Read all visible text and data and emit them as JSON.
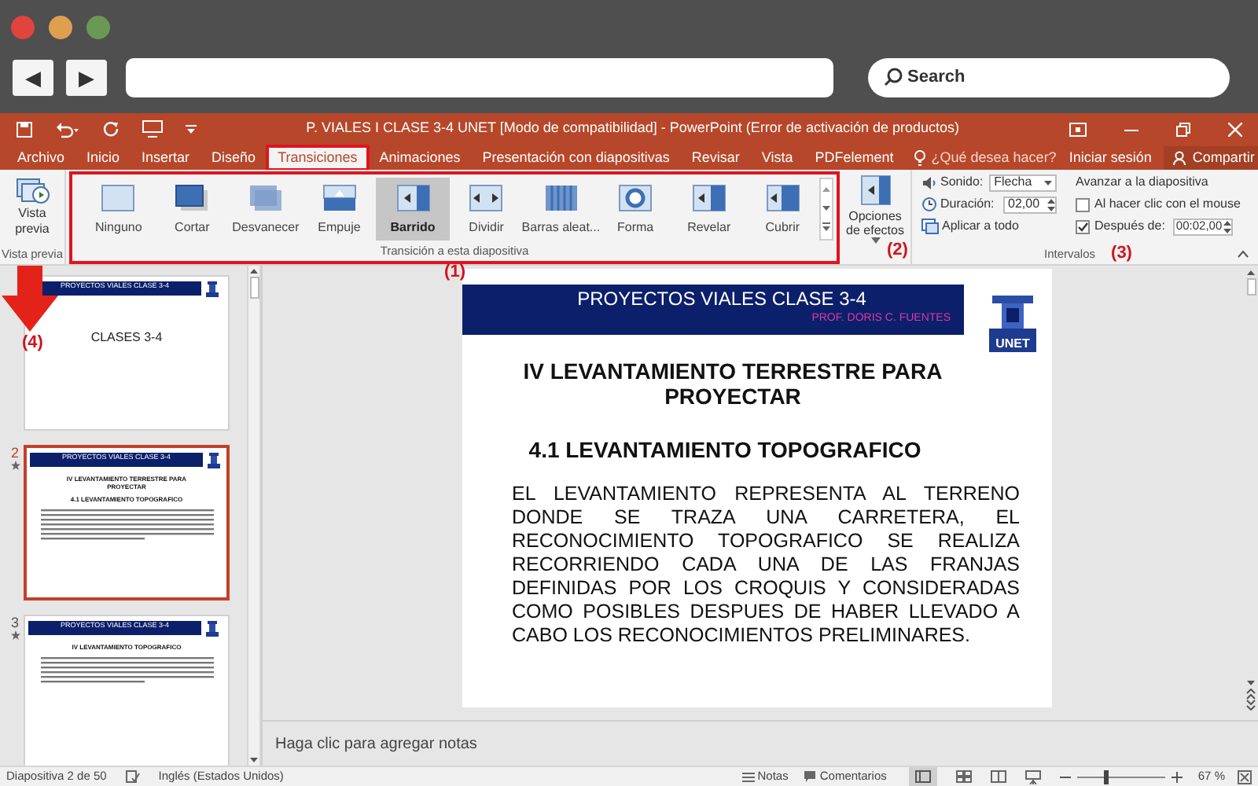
{
  "browser": {
    "back": "◀",
    "forward": "▶",
    "search_placeholder": "Search"
  },
  "app": {
    "title": "P. VIALES I  CLASE 3-4 UNET [Modo de compatibilidad] - PowerPoint (Error de activación de productos)",
    "tabs": [
      {
        "label": "Archivo",
        "selected": false
      },
      {
        "label": "Inicio",
        "selected": false
      },
      {
        "label": "Insertar",
        "selected": false
      },
      {
        "label": "Diseño",
        "selected": false
      },
      {
        "label": "Transiciones",
        "selected": true
      },
      {
        "label": "Animaciones",
        "selected": false
      },
      {
        "label": "Presentación con diapositivas",
        "selected": false
      },
      {
        "label": "Revisar",
        "selected": false
      },
      {
        "label": "Vista",
        "selected": false
      },
      {
        "label": "PDFelement",
        "selected": false
      }
    ],
    "tell_me": "¿Qué desea hacer?",
    "sign_in": "Iniciar sesión",
    "share": "Compartir"
  },
  "ribbon": {
    "preview": {
      "button": "Vista previa",
      "group_label": "Vista previa"
    },
    "gallery": {
      "group_label": "Transición a esta diapositiva",
      "annotation": "(1)",
      "items": [
        {
          "label": "Ninguno",
          "kind": "none",
          "selected": false
        },
        {
          "label": "Cortar",
          "kind": "cut",
          "selected": false
        },
        {
          "label": "Desvanecer",
          "kind": "fade",
          "selected": false
        },
        {
          "label": "Empuje",
          "kind": "push",
          "selected": false
        },
        {
          "label": "Barrido",
          "kind": "wipe",
          "selected": true
        },
        {
          "label": "Dividir",
          "kind": "split",
          "selected": false
        },
        {
          "label": "Barras aleat...",
          "kind": "bars",
          "selected": false
        },
        {
          "label": "Forma",
          "kind": "shape",
          "selected": false
        },
        {
          "label": "Revelar",
          "kind": "reveal",
          "selected": false
        },
        {
          "label": "Cubrir",
          "kind": "cover",
          "selected": false
        }
      ]
    },
    "effect_options": {
      "label": "Opciones de efectos",
      "annotation": "(2)"
    },
    "timing": {
      "group_label": "Intervalos",
      "annotation": "(3)",
      "sound": {
        "label": "Sonido:",
        "value": "Flecha"
      },
      "duration": {
        "label": "Duración:",
        "value": "02,00"
      },
      "apply_all": "Aplicar a todo",
      "advance_title": "Avanzar a la diapositiva",
      "on_click": {
        "label": "Al hacer clic con el mouse",
        "checked": false
      },
      "after": {
        "label": "Después de:",
        "checked": true,
        "value": "00:02,00"
      }
    }
  },
  "slides_pane": {
    "annotation": "(4)",
    "slides": [
      {
        "star": false,
        "selected": false,
        "header": "PROYECTOS VIALES  CLASE  3-4",
        "title": "CLASES 3-4",
        "kind": "cover"
      },
      {
        "number": "2",
        "star": true,
        "selected": true,
        "header": "PROYECTOS VIALES  CLASE  3-4",
        "title": "IV LEVANTAMIENTO TERRESTRE PARA PROYECTAR",
        "subtitle": "4.1  LEVANTAMIENTO TOPOGRAFICO",
        "kind": "content"
      },
      {
        "number": "3",
        "star": true,
        "selected": false,
        "header": "PROYECTOS VIALES  CLASE  3-4",
        "title": "IV LEVANTAMIENTO TOPOGRAFICO",
        "kind": "content"
      }
    ]
  },
  "slide": {
    "header": "PROYECTOS VIALES  CLASE  3-4",
    "author": "PROF. DORIS C. FUENTES",
    "logo_text": "UNET",
    "title": "IV LEVANTAMIENTO TERRESTRE PARA PROYECTAR",
    "subtitle": "4.1  LEVANTAMIENTO TOPOGRAFICO",
    "body": "EL LEVANTAMIENTO REPRESENTA AL TERRENO DONDE SE TRAZA UNA CARRETERA, EL RECONOCIMIENTO TOPOGRAFICO SE REALIZA RECORRIENDO CADA UNA DE LAS FRANJAS DEFINIDAS POR LOS CROQUIS Y CONSIDERADAS COMO POSIBLES DESPUES DE HABER LLEVADO A CABO LOS RECONOCIMIENTOS PRELIMINARES."
  },
  "notes_placeholder": "Haga clic para agregar notas",
  "status_bar": {
    "slide": "Diapositiva 2 de 50",
    "language": "Inglés (Estados Unidos)",
    "notes": "Notas",
    "comments": "Comentarios",
    "zoom": {
      "level": 0.32,
      "reading": "67 %"
    }
  }
}
